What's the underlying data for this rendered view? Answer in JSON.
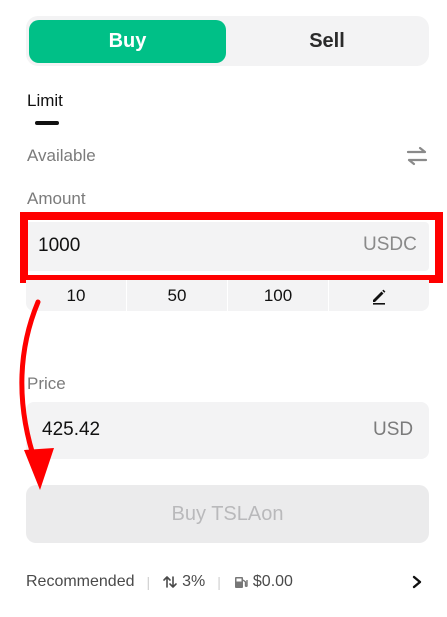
{
  "toggle": {
    "buy_label": "Buy",
    "sell_label": "Sell",
    "active": "buy"
  },
  "order_type": {
    "label": "Limit"
  },
  "available": {
    "label": "Available",
    "icon": "swap-icon"
  },
  "amount": {
    "label": "Amount",
    "value": "1000",
    "unit": "USDC",
    "quick_options": [
      "10",
      "50",
      "100"
    ],
    "edit_icon": "pencil-icon"
  },
  "price": {
    "label": "Price",
    "value": "425.42",
    "unit": "USD"
  },
  "submit": {
    "label": "Buy TSLAon"
  },
  "footer": {
    "recommended_label": "Recommended",
    "slippage": "3%",
    "fee": "$0.00"
  },
  "colors": {
    "accent": "#00c087",
    "highlight": "#ff0000",
    "annotation_arrow": "#ff0000",
    "field_bg": "#f3f3f4"
  }
}
